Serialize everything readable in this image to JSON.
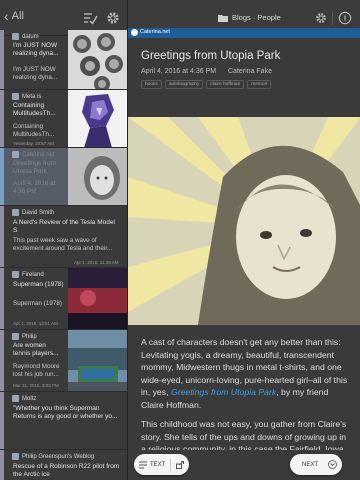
{
  "left_toolbar": {
    "back_label": "All"
  },
  "feed": [
    {
      "source": "datum",
      "title": "I'm JUST NOW realizing dyna...",
      "excerpt": "I'm JUST NOW realizing dyna...",
      "time": "",
      "stripe": "#8f8fa0"
    },
    {
      "source": "Meta is",
      "title": "Containing MultitudesTh...",
      "excerpt": "Containing MultitudesTh...",
      "time": "Yesterday, 10:57 AM",
      "stripe": "#8f8fa0"
    },
    {
      "source": "Caterina.net",
      "title": "Greetings from Utopia Park",
      "excerpt": "April 4, 2016 at 4:36 PM",
      "time": "",
      "stripe": "#7fa0c6"
    },
    {
      "source": "David Smith",
      "title": "A Nerd's Review of the Tesla Model S",
      "excerpt": "This past week saw a wave of excitement around Tesla and their...",
      "time": "Apr 1, 2016, 11:26 AM",
      "stripe": "#8f8fa0"
    },
    {
      "source": "Fireland",
      "title": "Superman (1978)",
      "excerpt": "Superman (1978)",
      "time": "Apr 1, 2016, 12:51 AM",
      "stripe": "#8f8fa0"
    },
    {
      "source": "Philip",
      "title": "Are women tennis players...",
      "excerpt": "Raymond Moore lost his job run...",
      "time": "Mar 31, 2016, 9:03 PM",
      "stripe": "#8f8fa0"
    },
    {
      "source": "Moltz",
      "title": "\"Whether you think Superman Returns is any good or whether yo...",
      "excerpt": "",
      "time": "",
      "stripe": "#8f8fa0"
    },
    {
      "source": "Philip Greenspun's Weblog",
      "title": "Rescue of a Robinson R22 pilot from the Arctic ice",
      "excerpt": "",
      "time": "",
      "stripe": "#8f8fa0"
    }
  ],
  "right_toolbar": {
    "folder_label": "Blogs · People"
  },
  "blog": {
    "name": "Caterina.net"
  },
  "article": {
    "title": "Greetings from Utopia Park",
    "date": "April 4, 2016 at 4:36 PM",
    "author": "Caterina Fake",
    "tags": [
      "books",
      "autobiography",
      "claire hoffman",
      "memoir"
    ],
    "p1_before": "A cast of characters doesn't get any better than this: Levitating yogis, a dreamy, beautiful, transcendent mommy, Midwestern thugs in metal t-shirts, and one wide-eyed, unicorn-loving, pure-hearted girl–all of this in, yes, ",
    "p1_link": "Greetings from Utopia Park",
    "p1_after": ", by my friend Claire Hoffman.",
    "p2": "This childhood was not easy, you gather from Claire's story. She tells of the ups and downs of growing up in a religious community, in this case the Fairfield, Iowa ... built by the famous guru ... the home of Transcendental"
  },
  "bottom": {
    "text_label": "TEXT",
    "next_label": "NEXT"
  },
  "colors": {
    "accent_link": "#3ea0e6",
    "blog_bar": "#1f5d99",
    "selected_row": "#565d66"
  }
}
